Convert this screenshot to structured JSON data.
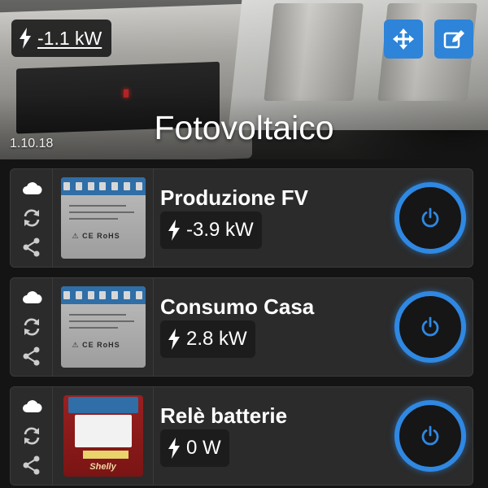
{
  "header": {
    "total_power": "-1.1 kW",
    "room_name": "Fotovoltaico",
    "version": "1.10.18",
    "move_icon": "move-arrows-icon",
    "edit_icon": "edit-icon"
  },
  "devices": [
    {
      "name": "Produzione FV",
      "power": "-3.9 kW",
      "image": "shelly-em-device",
      "icons": [
        "cloud-icon",
        "sync-icon",
        "share-icon"
      ]
    },
    {
      "name": "Consumo Casa",
      "power": "2.8 kW",
      "image": "shelly-em-device",
      "icons": [
        "cloud-icon",
        "sync-icon",
        "share-icon"
      ]
    },
    {
      "name": "Relè batterie",
      "power": "0 W",
      "image": "shelly-1-device",
      "icons": [
        "cloud-icon",
        "sync-icon",
        "share-icon"
      ]
    }
  ],
  "colors": {
    "accent": "#2f88e2",
    "background": "#141414",
    "card": "#2b2b2b"
  }
}
